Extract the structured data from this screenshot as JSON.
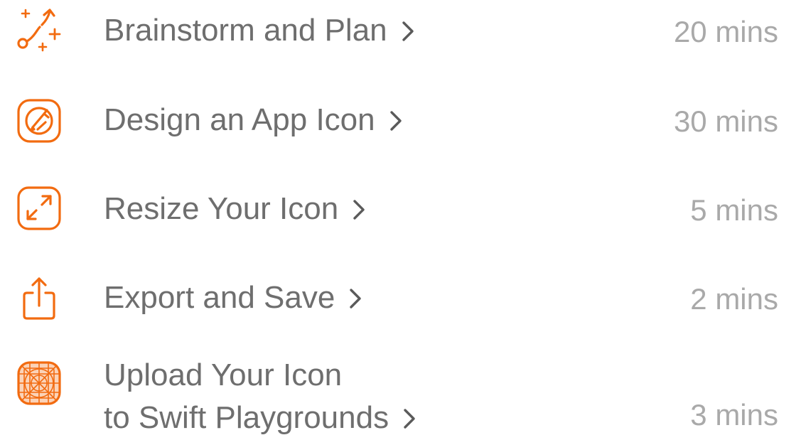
{
  "accent_color": "#f26b10",
  "text_color": "#6e6e6e",
  "duration_color": "#a9a9a9",
  "steps": [
    {
      "icon": "sparkle-path-icon",
      "title": "Brainstorm and Plan",
      "duration": "20 mins"
    },
    {
      "icon": "design-pencil-icon",
      "title": "Design an App Icon",
      "duration": "30 mins"
    },
    {
      "icon": "resize-arrows-icon",
      "title": "Resize Your Icon",
      "duration": "5 mins"
    },
    {
      "icon": "share-export-icon",
      "title": "Export and Save",
      "duration": "2 mins"
    },
    {
      "icon": "icon-grid-template-icon",
      "title_line1": "Upload Your Icon",
      "title_line2": "to Swift Playgrounds",
      "duration": "3 mins"
    }
  ]
}
